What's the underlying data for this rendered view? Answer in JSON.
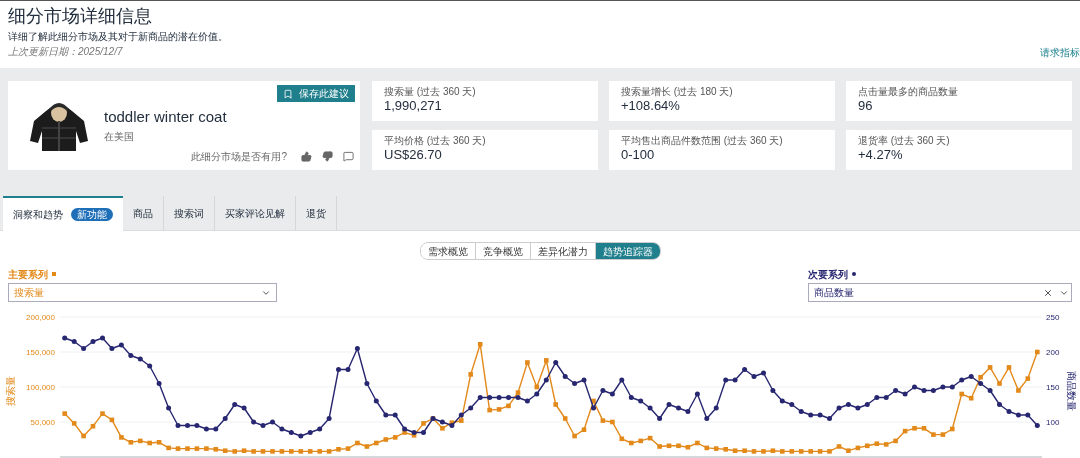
{
  "header": {
    "title": "细分市场详细信息",
    "subtitle": "详细了解此细分市场及其对于新商品的潜在价值。",
    "updated": "上次更新日期：2025/12/7",
    "link": "请求指标"
  },
  "product": {
    "save_button": "保存此建议",
    "name": "toddler winter coat",
    "region": "在美国",
    "feedback_question": "此细分市场是否有用?"
  },
  "stats": [
    {
      "label": "搜索量 (过去 360 天)",
      "value": "1,990,271"
    },
    {
      "label": "搜索量增长 (过去 180 天)",
      "value": "+108.64%"
    },
    {
      "label": "点击量最多的商品数量",
      "value": "96"
    },
    {
      "label": "平均价格 (过去 360 天)",
      "value": "US$26.70"
    },
    {
      "label": "平均售出商品件数范围 (过去 360 天)",
      "value": "0-100"
    },
    {
      "label": "退货率 (过去 360 天)",
      "value": "+4.27%"
    }
  ],
  "tabs": [
    {
      "label": "洞察和趋势",
      "badge": "新功能",
      "selected": true
    },
    {
      "label": "商品",
      "selected": false
    },
    {
      "label": "搜索词",
      "selected": false
    },
    {
      "label": "买家评论见解",
      "selected": false
    },
    {
      "label": "退货",
      "selected": false
    }
  ],
  "views": [
    {
      "label": "需求概览",
      "selected": false
    },
    {
      "label": "竞争概览",
      "selected": false
    },
    {
      "label": "差异化潜力",
      "selected": false
    },
    {
      "label": "趋势追踪器",
      "selected": true
    }
  ],
  "primary_series": {
    "label": "主要系列",
    "color": "#e3891a"
  },
  "secondary_series": {
    "label": "次要系列",
    "color": "#272670"
  },
  "chart_data": {
    "type": "line",
    "grid": true,
    "ylabel": "搜索量",
    "y2label": "商品数量",
    "ylim": [
      0,
      200000
    ],
    "y2lim": [
      50,
      250
    ],
    "yticks": [
      {
        "value": 200000,
        "label": "200,000"
      },
      {
        "value": 150000,
        "label": "150,000"
      },
      {
        "value": 100000,
        "label": "100,000"
      },
      {
        "value": 50000,
        "label": "50,000"
      }
    ],
    "y2ticks": [
      250,
      200,
      150,
      100
    ],
    "series": [
      {
        "name": "搜索量",
        "color": "#e3891a",
        "marker": "square",
        "values": [
          62000,
          48000,
          30000,
          44000,
          62000,
          53000,
          28000,
          21000,
          23000,
          20000,
          21000,
          13000,
          12000,
          12000,
          12000,
          12000,
          11000,
          9000,
          8000,
          9000,
          8000,
          8000,
          8000,
          8000,
          8000,
          8000,
          8000,
          8000,
          8000,
          11000,
          12000,
          20000,
          15000,
          20000,
          25000,
          28000,
          35000,
          31000,
          48000,
          55000,
          41000,
          49000,
          52000,
          118000,
          161000,
          67000,
          68000,
          73000,
          92000,
          135000,
          100000,
          138000,
          75000,
          55000,
          30000,
          39000,
          80000,
          52000,
          50000,
          26000,
          20000,
          23000,
          27000,
          15000,
          16000,
          16000,
          14000,
          20000,
          13000,
          12000,
          11000,
          9000,
          9000,
          8000,
          8000,
          9000,
          8000,
          8000,
          8000,
          8000,
          8000,
          8000,
          15000,
          9000,
          13000,
          16000,
          19000,
          18000,
          23000,
          37000,
          41000,
          41000,
          32000,
          32000,
          40000,
          90000,
          84000,
          114000,
          128000,
          105000,
          128000,
          95000,
          112000,
          150000
        ]
      },
      {
        "name": "商品数量",
        "color": "#272670",
        "axis": "y2",
        "values": [
          220,
          215,
          205,
          215,
          220,
          205,
          210,
          195,
          190,
          180,
          155,
          120,
          95,
          95,
          95,
          90,
          90,
          105,
          125,
          120,
          100,
          95,
          100,
          90,
          85,
          80,
          85,
          90,
          105,
          175,
          175,
          205,
          155,
          130,
          110,
          110,
          90,
          85,
          85,
          105,
          100,
          95,
          110,
          120,
          135,
          135,
          135,
          135,
          135,
          130,
          140,
          160,
          185,
          165,
          155,
          160,
          120,
          145,
          140,
          160,
          135,
          130,
          120,
          105,
          125,
          120,
          115,
          140,
          105,
          120,
          160,
          160,
          175,
          165,
          170,
          145,
          130,
          125,
          115,
          110,
          110,
          105,
          120,
          125,
          120,
          125,
          135,
          135,
          145,
          140,
          150,
          145,
          145,
          150,
          150,
          160,
          165,
          155,
          145,
          125,
          115,
          110,
          110,
          95
        ]
      }
    ]
  }
}
